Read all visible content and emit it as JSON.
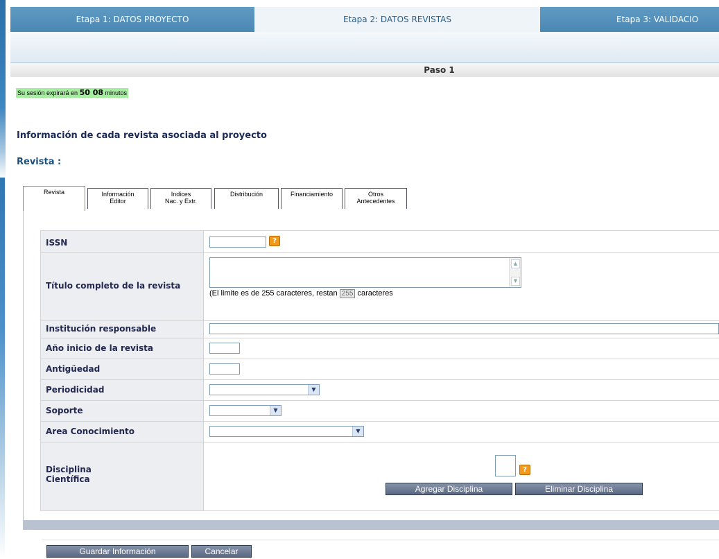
{
  "stages": [
    {
      "label": "Etapa 1: DATOS PROYECTO",
      "active": false
    },
    {
      "label": "Etapa 2: DATOS REVISTAS",
      "active": true
    },
    {
      "label": "Etapa 3: VALIDACIO",
      "active": false
    }
  ],
  "step": "Paso 1",
  "session": {
    "prefix": "Su sesión expirará en",
    "time": "50 08",
    "suffix": "minutos"
  },
  "headings": {
    "info": "Información de cada revista asociada al proyecto",
    "revista": "Revista :"
  },
  "subtabs": [
    {
      "line1": "Revista",
      "line2": ""
    },
    {
      "line1": "Información",
      "line2": "Editor"
    },
    {
      "line1": "Indices",
      "line2": "Nac. y Extr."
    },
    {
      "line1": "Distribución",
      "line2": ""
    },
    {
      "line1": "Financiamiento",
      "line2": ""
    },
    {
      "line1": "Otros",
      "line2": "Antecedentes"
    }
  ],
  "form": {
    "issn": {
      "label": "ISSN",
      "value": "",
      "help": "?"
    },
    "titulo": {
      "label": "Título completo de la revista",
      "value": "",
      "limit_prefix": "(El limite es de 255 caracteres, restan",
      "remaining": "255",
      "limit_suffix": "caracteres"
    },
    "institucion": {
      "label": "Institución responsable",
      "value": ""
    },
    "anio": {
      "label": "Año inicio de la revista",
      "value": ""
    },
    "antiguedad": {
      "label": "Antigüedad",
      "value": ""
    },
    "periodicidad": {
      "label": "Periodicidad",
      "selected": ""
    },
    "soporte": {
      "label": "Soporte",
      "selected": ""
    },
    "area": {
      "label": "Area Conocimiento",
      "selected": ""
    },
    "disciplina": {
      "label_line1": "Disciplina",
      "label_line2": "Científica",
      "help": "?",
      "add_label": "Agregar Disciplina",
      "remove_label": "Eliminar Disciplina"
    }
  },
  "actions": {
    "save_label": "Guardar Información",
    "cancel_label": "Cancelar"
  }
}
